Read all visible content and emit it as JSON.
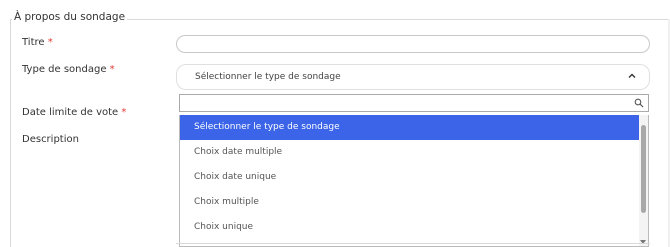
{
  "section": {
    "legend": "À propos du sondage"
  },
  "form": {
    "titre_label": "Titre",
    "type_label": "Type de sondage",
    "date_label": "Date limite de vote",
    "description_label": "Description",
    "required_mark": "*",
    "titre_value": "",
    "type_selected": "Sélectionner le type de sondage"
  },
  "dropdown": {
    "search_value": "",
    "options": [
      "Sélectionner le type de sondage",
      "Choix date multiple",
      "Choix date unique",
      "Choix multiple",
      "Choix unique"
    ],
    "selected_index": 0
  },
  "icons": {
    "caret": "chevron-up-icon",
    "search": "search-icon"
  },
  "colors": {
    "highlight": "#3b64e8",
    "required": "#e53935"
  }
}
